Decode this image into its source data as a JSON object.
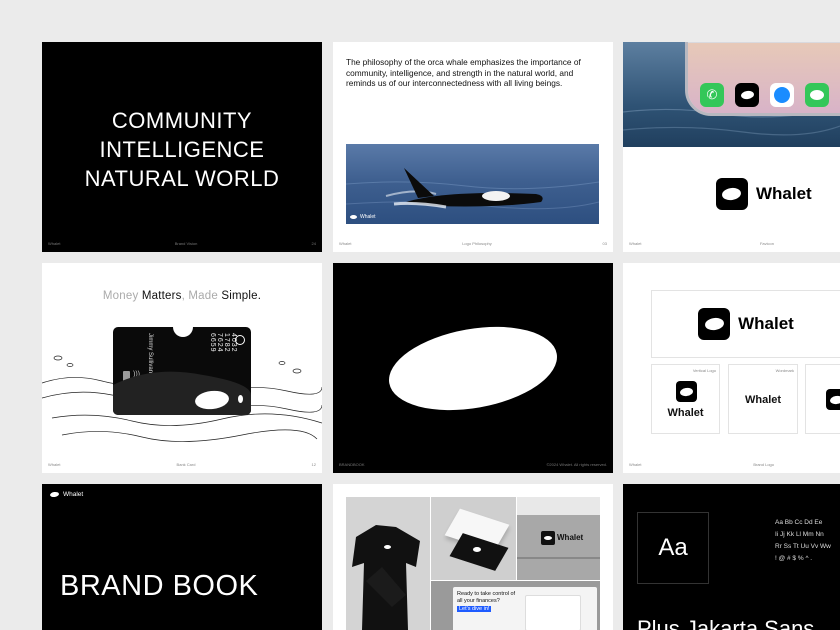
{
  "slide1": {
    "lines": [
      "COMMUNITY",
      "INTELLIGENCE",
      "NATURAL WORLD"
    ],
    "footer": {
      "left": "Whalet",
      "center": "Brand Vision",
      "right": "24"
    }
  },
  "slide2": {
    "text": "The philosophy of the orca whale emphasizes the importance of community, intelligence, and strength in the natural world, and reminds us of our interconnectedness with all living beings.",
    "photo_tag": "Whalet",
    "footer": {
      "left": "Whalet",
      "center": "Logo Philosophy",
      "right": "03"
    }
  },
  "slide3": {
    "wordmark": "Whalet",
    "footer": {
      "left": "Whalet",
      "center": "Favicon",
      "right": ""
    }
  },
  "slide4": {
    "tagline_parts": [
      {
        "text": "Money ",
        "muted": true
      },
      {
        "text": "Matters",
        "muted": false
      },
      {
        "text": ", Made ",
        "muted": true
      },
      {
        "text": "Simple.",
        "muted": false
      }
    ],
    "card": {
      "name": "Jimmy Sullivan",
      "number": "4032 1782 7624 6659"
    },
    "footer": {
      "left": "Whalet",
      "center": "Bank Card",
      "right": "12"
    }
  },
  "slide5": {
    "footer": {
      "left": "BRANDBOOK",
      "center": "",
      "right": "©2024 Whalet. All rights reserved."
    }
  },
  "slide6": {
    "wordmark": "Whalet",
    "vertical_label": "Vertical Logo",
    "wordmark_label": "Wordmark",
    "footer": {
      "left": "Whalet",
      "center": "Brand Logo",
      "right": ""
    }
  },
  "slide7": {
    "brand": "Whalet",
    "title": "BRAND BOOK"
  },
  "slide8": {
    "building_sign": "Whalet",
    "billboard_text": "Ready to take control of all your finances?",
    "billboard_cta": "Let's dive in!"
  },
  "slide9": {
    "specimen": "Aa",
    "glyph_rows": [
      "Aa Bb Cc Dd Ee",
      "Ii Jj Kk Ll Mm Nn",
      "Rr Ss Tt Uu Vv Ww",
      "! @ # $ % ^ ."
    ],
    "font_name": "Plus Jakarta Sans"
  },
  "colors": {
    "accent": "#1e5bff",
    "dark": "#000000",
    "bg": "#ebebeb"
  }
}
